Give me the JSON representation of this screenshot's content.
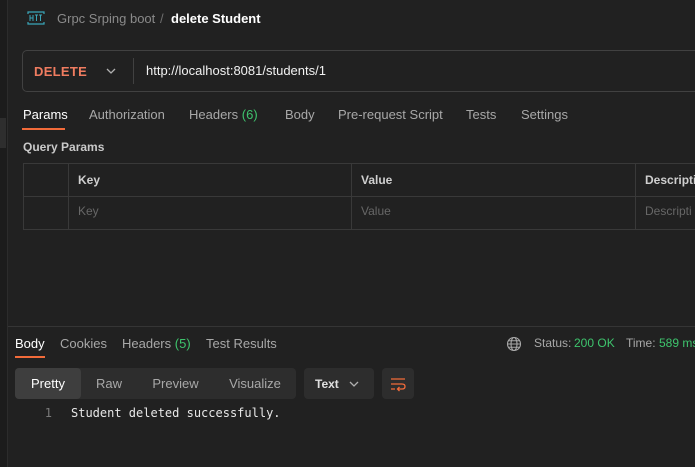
{
  "breadcrumb": {
    "parent": "Grpc Srping boot",
    "separator": "/",
    "current": "delete Student",
    "icon": "http-request-icon"
  },
  "request": {
    "method": "DELETE",
    "url": "http://localhost:8081/students/1",
    "method_color": "#f07c60"
  },
  "request_tabs": {
    "params": "Params",
    "authorization": "Authorization",
    "headers": "Headers",
    "headers_count": "(6)",
    "body": "Body",
    "prerequest": "Pre-request Script",
    "tests": "Tests",
    "settings": "Settings",
    "active": "Params"
  },
  "query_params": {
    "title": "Query Params",
    "columns": [
      "Key",
      "Value",
      "Descripti"
    ],
    "placeholders": [
      "Key",
      "Value",
      "Descripti"
    ]
  },
  "response_tabs": {
    "body": "Body",
    "cookies": "Cookies",
    "headers": "Headers",
    "headers_count": "(5)",
    "test_results": "Test Results",
    "active": "Body"
  },
  "response_status": {
    "status_label": "Status:",
    "status_value": "200 OK",
    "time_label": "Time:",
    "time_value": "589 ms"
  },
  "response_format": {
    "options": [
      "Pretty",
      "Raw",
      "Preview",
      "Visualize"
    ],
    "active": "Pretty",
    "type": "Text"
  },
  "response_body": {
    "lines": [
      {
        "number": "1",
        "text": "Student deleted successfully."
      }
    ]
  },
  "colors": {
    "accent": "#f26b3a",
    "success": "#3ec46d",
    "background": "#212121"
  }
}
